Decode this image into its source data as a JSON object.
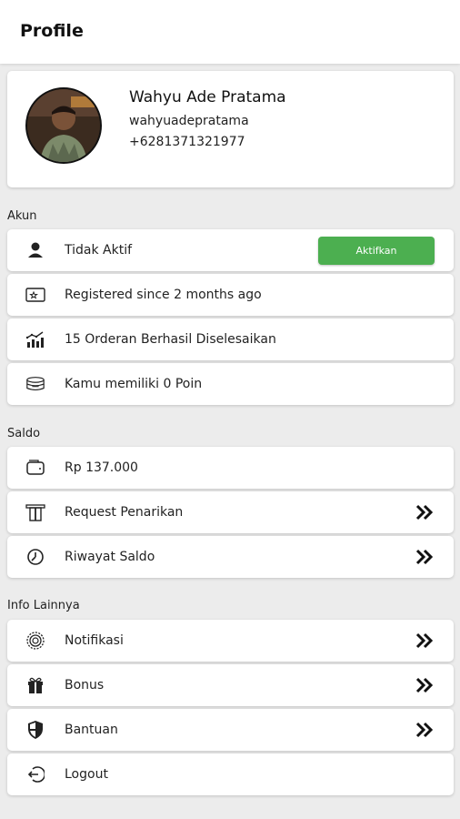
{
  "header": {
    "title": "Profile"
  },
  "profile": {
    "name": "Wahyu Ade Pratama",
    "username": "wahyuadepratama",
    "phone": "+6281371321977"
  },
  "akun": {
    "section_label": "Akun",
    "status_label": "Tidak Aktif",
    "activate_button": "Aktifkan",
    "registered": "Registered since 2 months ago",
    "orders": "15 Orderan Berhasil Diselesaikan",
    "points": "Kamu memiliki 0 Poin"
  },
  "saldo": {
    "section_label": "Saldo",
    "balance": "Rp 137.000",
    "withdraw": "Request Penarikan",
    "history": "Riwayat Saldo"
  },
  "info": {
    "section_label": "Info Lainnya",
    "notifications": "Notifikasi",
    "bonus": "Bonus",
    "help": "Bantuan",
    "logout": "Logout"
  },
  "colors": {
    "accent": "#4caf50",
    "background": "#ececec"
  },
  "icons": {
    "status": "person-icon",
    "registered": "star-card-icon",
    "orders": "chart-icon",
    "points": "coins-icon",
    "balance": "wallet-icon",
    "withdraw": "withdraw-icon",
    "history": "clock-icon",
    "notifications": "badge-icon",
    "bonus": "gift-icon",
    "help": "shield-icon",
    "logout": "logout-icon",
    "next": "double-chevron-right-icon"
  }
}
